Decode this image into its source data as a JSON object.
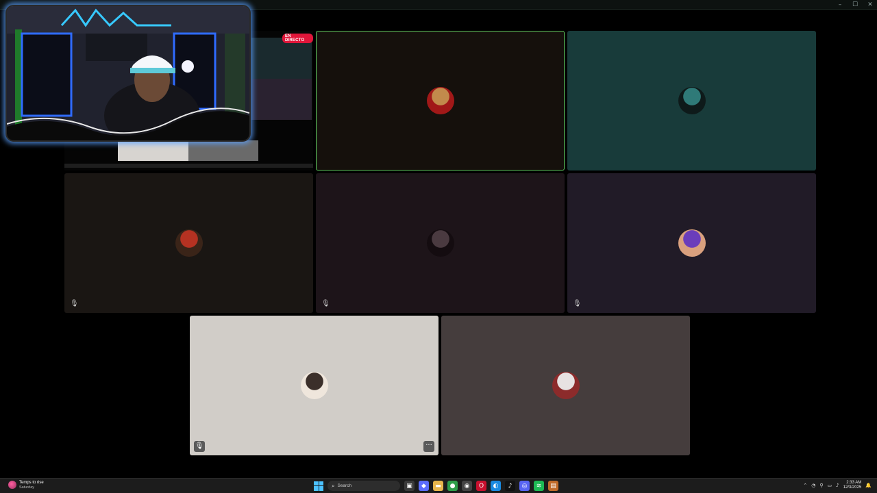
{
  "window": {
    "controls": {
      "minimize": "–",
      "maximize": "☐",
      "close": "✕"
    }
  },
  "stream": {
    "live_badge": "EN DIRECTO"
  },
  "tiles": [
    {
      "id": "speaker",
      "bg": "#15100c",
      "speaking": true,
      "avatar_colors": [
        "#c28a4c",
        "#a11818"
      ],
      "muted": false
    },
    {
      "id": "teal",
      "bg": "#183b3a",
      "speaking": false,
      "avatar_colors": [
        "#2f7a78",
        "#0e1a1a"
      ],
      "muted": false
    },
    {
      "id": "dark-brown",
      "bg": "#1a1613",
      "speaking": false,
      "avatar_colors": [
        "#b53222",
        "#3a2418"
      ],
      "muted": true
    },
    {
      "id": "plum",
      "bg": "#1d1419",
      "speaking": false,
      "avatar_colors": [
        "#4a3a40",
        "#140c10"
      ],
      "muted": true
    },
    {
      "id": "indigo",
      "bg": "#211b27",
      "speaking": false,
      "avatar_colors": [
        "#6a3dbb",
        "#d9a07e"
      ],
      "muted": true
    },
    {
      "id": "light",
      "bg": "#d1cdc8",
      "speaking": false,
      "avatar_colors": [
        "#3b2f2a",
        "#efe6dc"
      ],
      "muted": true
    },
    {
      "id": "grey",
      "bg": "#453d3d",
      "speaking": false,
      "avatar_colors": [
        "#e7e2e2",
        "#8c2b2b"
      ],
      "muted": false
    }
  ],
  "icons": {
    "mute": "🎙",
    "more": "···"
  },
  "taskbar": {
    "weather_title": "Temps to rise",
    "weather_sub": "Saturday",
    "search_placeholder": "Search",
    "clock_time": "2:33 AM",
    "clock_date": "12/3/2025",
    "apps": [
      {
        "name": "file-explorer-icon",
        "glyph": "▣",
        "color": "#3a3a3a"
      },
      {
        "name": "copilot-icon",
        "glyph": "◆",
        "color": "#5b6cff"
      },
      {
        "name": "folder-icon",
        "glyph": "▬",
        "color": "#e8b64c"
      },
      {
        "name": "chrome-icon",
        "glyph": "●",
        "color": "#2e9e4a"
      },
      {
        "name": "obs-icon",
        "glyph": "◉",
        "color": "#444"
      },
      {
        "name": "opera-icon",
        "glyph": "O",
        "color": "#c8102e"
      },
      {
        "name": "edge-icon",
        "glyph": "◐",
        "color": "#1a8ae0"
      },
      {
        "name": "tiktok-icon",
        "glyph": "♪",
        "color": "#111"
      },
      {
        "name": "discord-icon",
        "glyph": "◎",
        "color": "#5865f2"
      },
      {
        "name": "spotify-icon",
        "glyph": "≋",
        "color": "#1db954"
      },
      {
        "name": "app-icon",
        "glyph": "▤",
        "color": "#c06b2a"
      }
    ],
    "tray_icons": [
      "⌃",
      "◔",
      "⚲",
      "▭",
      "♪"
    ]
  }
}
